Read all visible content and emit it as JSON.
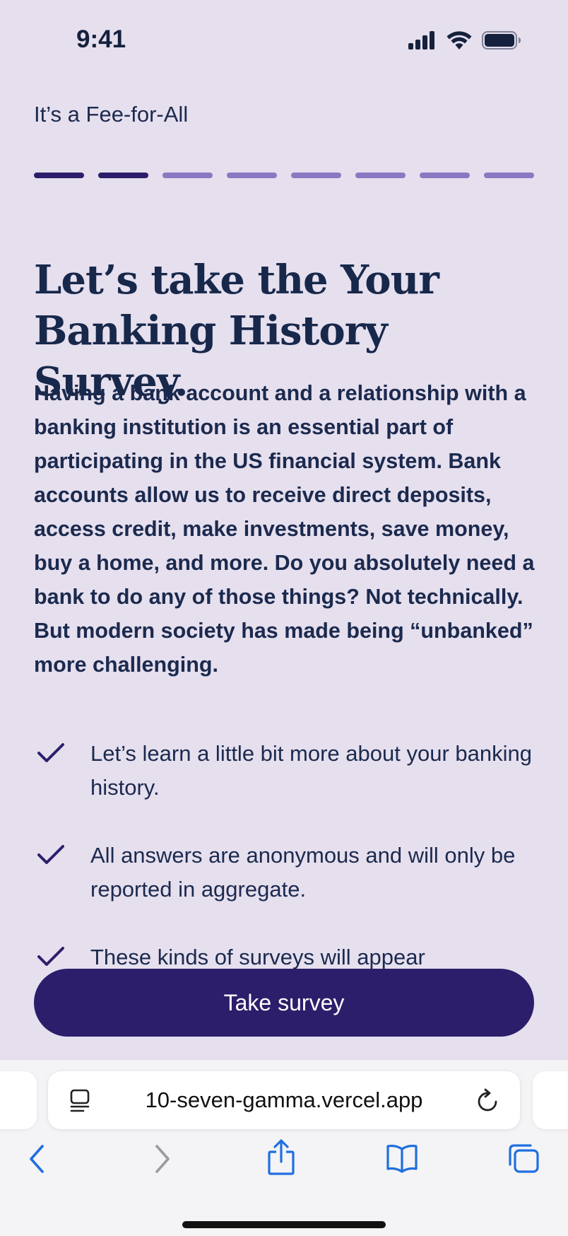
{
  "status_bar": {
    "time": "9:41"
  },
  "header": {
    "app_name": "It’s a Fee-for-All"
  },
  "progress": {
    "total_steps": 8,
    "completed_steps": 2,
    "done_color": "#2d1e6b",
    "todo_color": "#8b78c2"
  },
  "main": {
    "headline": "Let’s take the Your Banking History Survey.",
    "body": "Having a bank account and a relationship with a banking institution is an essential part of participating in the US financial system. Bank accounts allow us to receive direct deposits, access credit, make investments, save money, buy a home, and more. Do you absolutely need a bank to do any of those things? Not technically. But modern society has made being “unbanked” more challenging.",
    "checklist": [
      {
        "icon": "check-icon",
        "label": "Let’s learn a little bit more about your banking history."
      },
      {
        "icon": "check-icon",
        "label": "All answers are anonymous and will only be reported in aggregate."
      },
      {
        "icon": "check-icon",
        "label": "These kinds of surveys will appear"
      }
    ]
  },
  "cta": {
    "label": "Take survey",
    "color": "#2d1e6b"
  },
  "browser": {
    "url": "10-seven-gamma.vercel.app",
    "toolbar_icons": [
      "back-icon",
      "forward-icon",
      "share-icon",
      "bookmarks-icon",
      "tabs-icon"
    ]
  }
}
